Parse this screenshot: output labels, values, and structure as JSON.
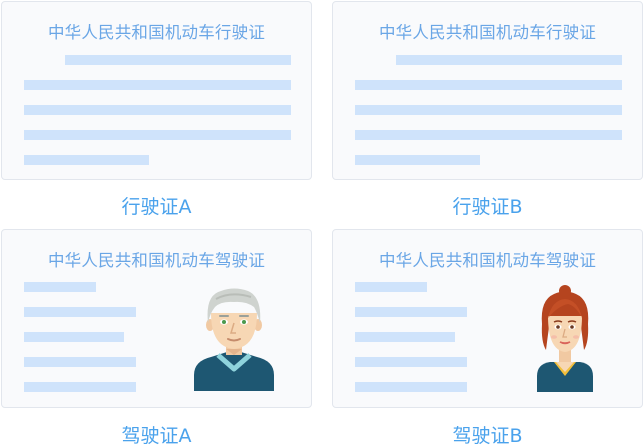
{
  "cards": [
    {
      "title": "中华人民共和国机动车行驶证",
      "caption": "行驶证A"
    },
    {
      "title": "中华人民共和国机动车行驶证",
      "caption": "行驶证B"
    },
    {
      "title": "中华人民共和国机动车驾驶证",
      "caption": "驾驶证A",
      "avatar": "male-avatar-icon"
    },
    {
      "title": "中华人民共和国机动车驾驶证",
      "caption": "驾驶证B",
      "avatar": "female-avatar-icon"
    }
  ],
  "colors": {
    "accent": "#4aa2ec",
    "placeholder_bar": "#cfe3fb",
    "card_bg": "#f9fafc"
  }
}
